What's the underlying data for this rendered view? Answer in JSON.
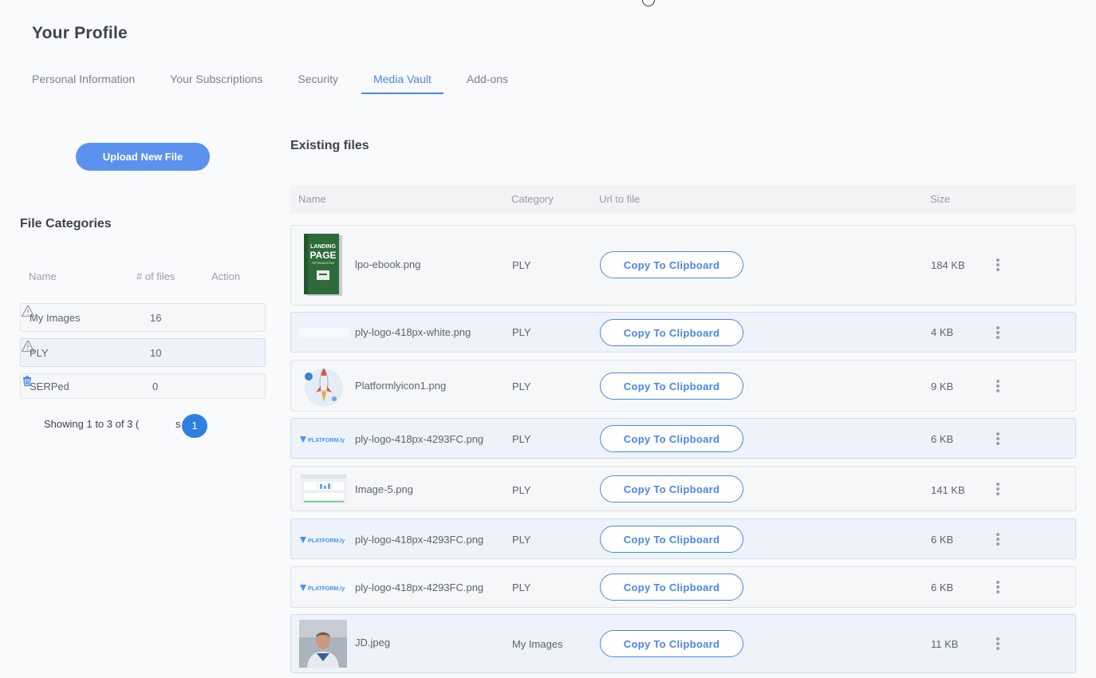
{
  "page": {
    "title": "Your Profile"
  },
  "tabs": [
    {
      "label": "Personal Information",
      "active": false
    },
    {
      "label": "Your Subscriptions",
      "active": false
    },
    {
      "label": "Security",
      "active": false
    },
    {
      "label": "Media Vault",
      "active": true
    },
    {
      "label": "Add-ons",
      "active": false
    }
  ],
  "sidebar": {
    "upload_label": "Upload New File",
    "categories_title": "File Categories",
    "columns": {
      "name": "Name",
      "count": "# of files",
      "action": "Action"
    },
    "categories": [
      {
        "name": "My Images",
        "count": "16",
        "action_icon": "warning-icon"
      },
      {
        "name": "PLY",
        "count": "10",
        "action_icon": "warning-icon"
      },
      {
        "name": "SERPed",
        "count": "0",
        "action_icon": "trash-icon"
      }
    ],
    "pagination": {
      "showing": "Showing 1 to 3 of 3 (",
      "suffix": "s",
      "current_page": "1"
    }
  },
  "files": {
    "title": "Existing files",
    "columns": {
      "name": "Name",
      "category": "Category",
      "url": "Url to file",
      "size": "Size"
    },
    "copy_label": "Copy To Clipboard",
    "rows": [
      {
        "name": "lpo-ebook.png",
        "category": "PLY",
        "size": "184 KB",
        "thumb": "ebook-cover",
        "thumb_text_1": "LANDING",
        "thumb_text_2": "PAGE",
        "thumb_text_3": "OPTIMIZATION"
      },
      {
        "name": "ply-logo-418px-white.png",
        "category": "PLY",
        "size": "4 KB",
        "thumb": "white-logo"
      },
      {
        "name": "Platformlyicon1.png",
        "category": "PLY",
        "size": "9 KB",
        "thumb": "rocket-icon"
      },
      {
        "name": "ply-logo-418px-4293FC.png",
        "category": "PLY",
        "size": "6 KB",
        "thumb": "blue-logo",
        "logo_text": "PLATFORM.ly"
      },
      {
        "name": "Image-5.png",
        "category": "PLY",
        "size": "141 KB",
        "thumb": "dashboard-screenshot"
      },
      {
        "name": "ply-logo-418px-4293FC.png",
        "category": "PLY",
        "size": "6 KB",
        "thumb": "blue-logo",
        "logo_text": "PLATFORM.ly"
      },
      {
        "name": "ply-logo-418px-4293FC.png",
        "category": "PLY",
        "size": "6 KB",
        "thumb": "blue-logo",
        "logo_text": "PLATFORM.ly"
      },
      {
        "name": "JD.jpeg",
        "category": "My Images",
        "size": "11 KB",
        "thumb": "person-photo"
      }
    ]
  },
  "colors": {
    "accent": "#4a86e8",
    "upload_button": "#5b92ef",
    "page_badge": "#2f7fe0"
  }
}
